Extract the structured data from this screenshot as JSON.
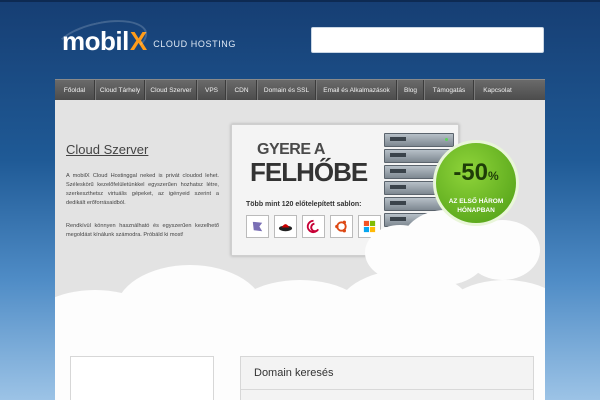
{
  "header": {
    "logo_word": "mobil",
    "logo_x": "X",
    "logo_tagline": "CLOUD HOSTING",
    "search_value": ""
  },
  "nav": {
    "items": [
      "Főoldal",
      "Cloud Tárhely",
      "Cloud Szerver",
      "VPS",
      "CDN",
      "Domain és SSL",
      "Email és Alkalmazások",
      "Blog",
      "Támogatás",
      "Kapcsolat"
    ]
  },
  "intro": {
    "title": "Cloud Szerver",
    "paragraph1": "A mobilX Cloud Hostinggal neked is privát cloudod lehet. Széleskörű kezelőfelületünkkel egyszerűen hozhatsz létre, szerkeszthetsz virtuális gépeket, az igényeid szerint a dedikált erőforrásaidból.",
    "paragraph2": "Rendkívül könnyen használható és egyszerűen kezelhető megoldást kínálunk számodra. Próbáld ki most!"
  },
  "banner": {
    "title_line1": "GYERE A",
    "title_line2": "FELHŐBE",
    "subtitle": "Több mint 120 előtelepített sablon:",
    "os_icons": [
      "gentoo-icon",
      "redhat-icon",
      "debian-icon",
      "ubuntu-icon",
      "windows-icon"
    ],
    "badge_value": "-50",
    "badge_pct": "%",
    "badge_text_line1": "AZ ELSŐ HÁROM",
    "badge_text_line2": "HÓNAPBAN"
  },
  "bottom": {
    "domain_title": "Domain keresés"
  },
  "colors": {
    "accent_orange": "#ff9c1a",
    "badge_green": "#6db726",
    "nav_bg": "#555555"
  }
}
